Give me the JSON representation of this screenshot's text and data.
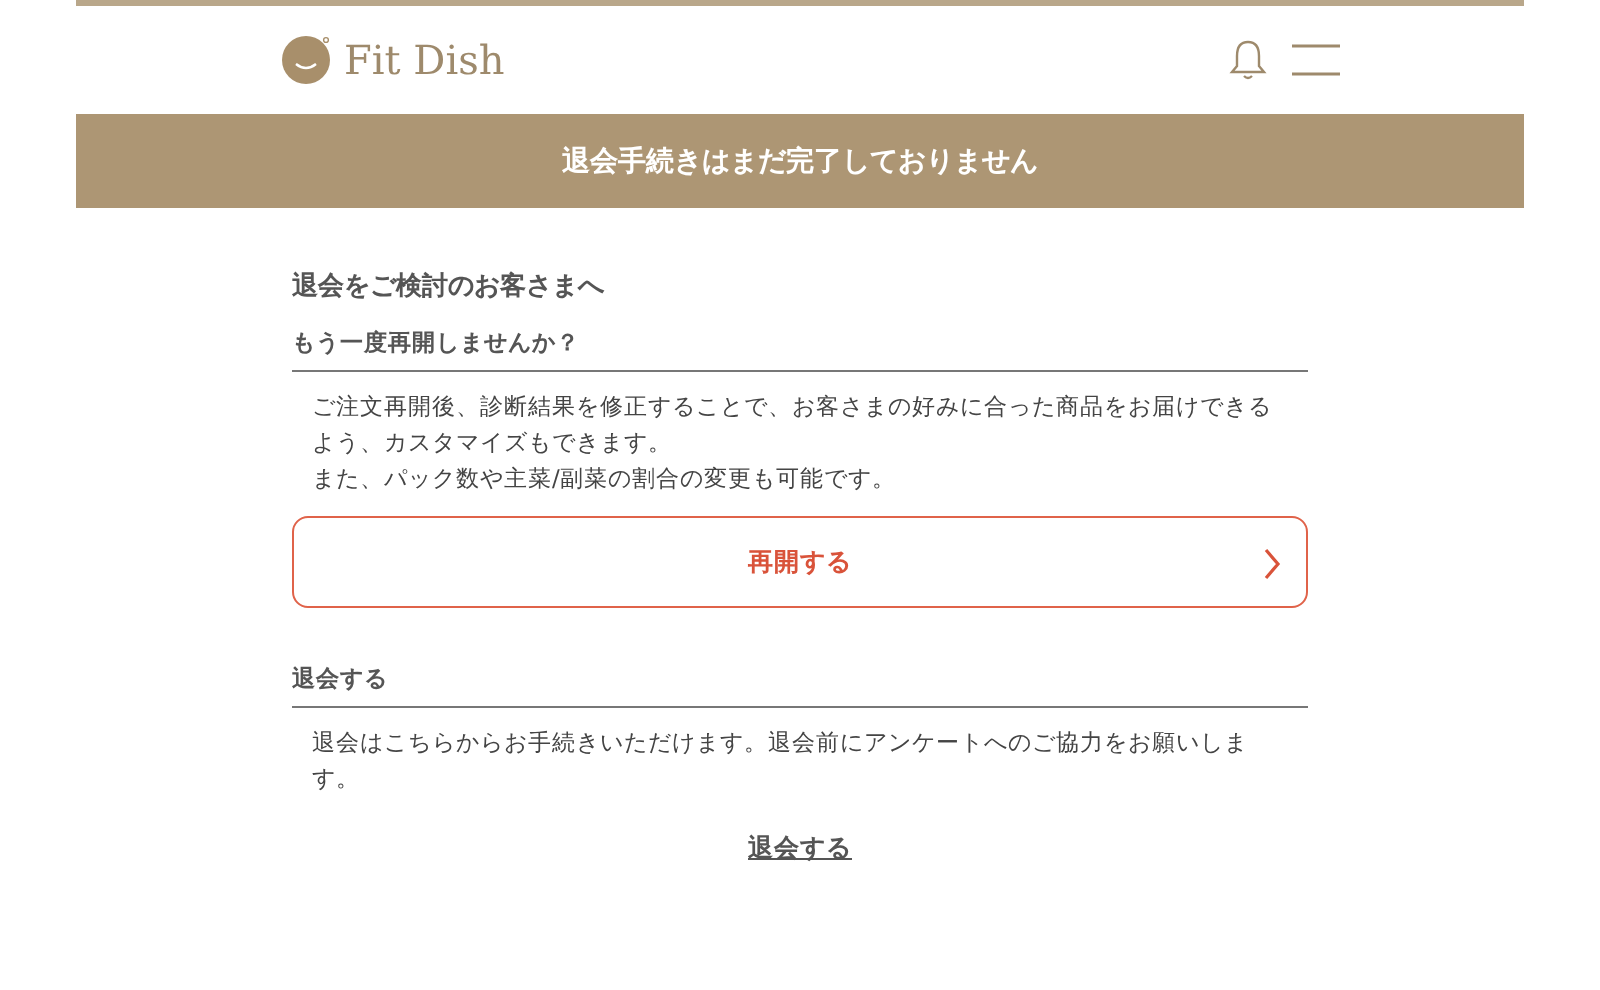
{
  "header": {
    "logo_text": "Fit Dish"
  },
  "banner": {
    "text": "退会手続きはまだ完了しておりません"
  },
  "heading": "退会をご検討のお客さまへ",
  "sections": [
    {
      "kind": "resume",
      "title": "もう一度再開しませんか？",
      "body": [
        "ご注文再開後、診断結果を修正することで、お客さまの好みに合った商品をお届けできるよう、カスタマイズもできます。",
        "また、パック数や主菜/副菜の割合の変更も可能です。"
      ],
      "action": "再開する"
    },
    {
      "kind": "cancel",
      "title": "退会する",
      "body": [
        "退会はこちらからお手続きいただけます。退会前にアンケートへのご協力をお願いします。"
      ],
      "action": "退会する"
    }
  ]
}
